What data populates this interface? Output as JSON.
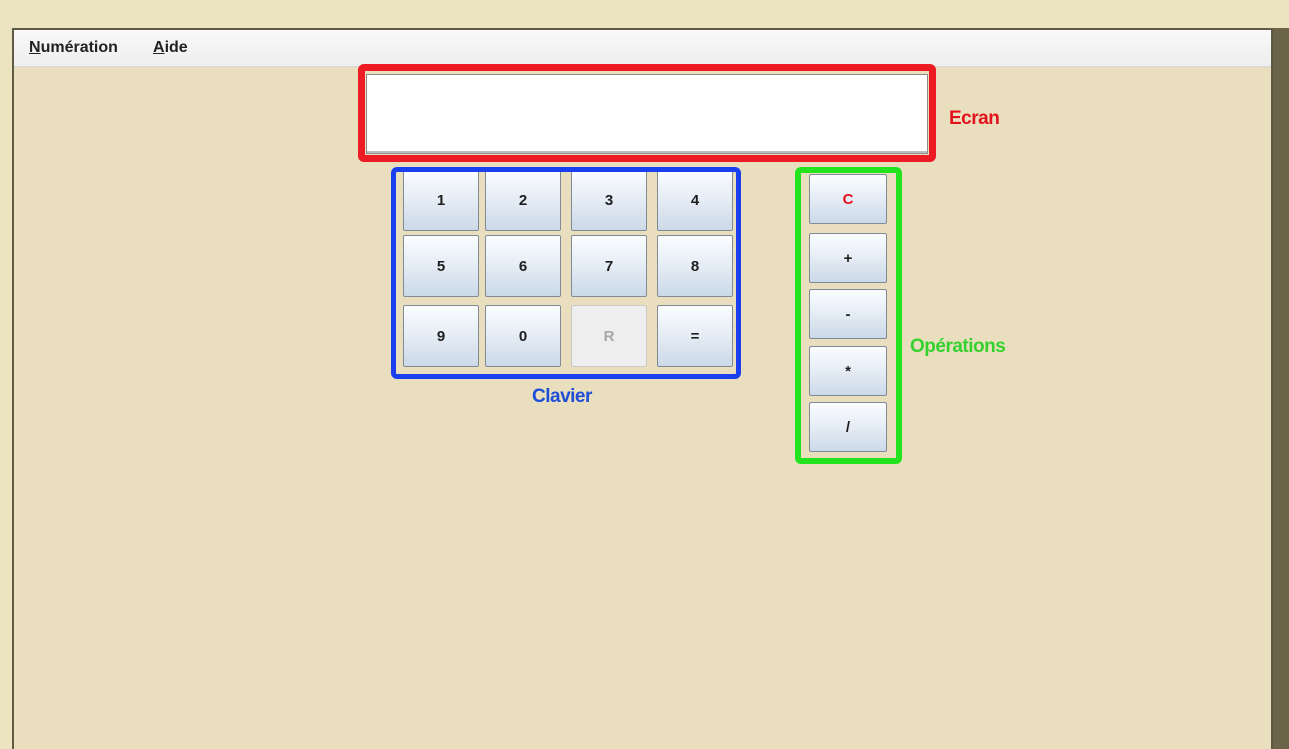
{
  "menubar": {
    "items": [
      {
        "mnemonic": "N",
        "rest": "umération"
      },
      {
        "mnemonic": "A",
        "rest": "ide"
      }
    ]
  },
  "screen": {
    "value": ""
  },
  "labels": {
    "ecran": "Ecran",
    "clavier": "Clavier",
    "operations": "Opérations"
  },
  "keypad": {
    "keys": [
      "1",
      "2",
      "3",
      "4",
      "5",
      "6",
      "7",
      "8",
      "9",
      "0",
      "R",
      "="
    ]
  },
  "operations": {
    "keys": [
      "C",
      "+",
      "-",
      "*",
      "/"
    ]
  },
  "colors": {
    "screen_frame": "#ec1b24",
    "keypad_frame": "#1a3ff0",
    "operations_frame": "#22e31e",
    "background": "#e9dfbe"
  }
}
